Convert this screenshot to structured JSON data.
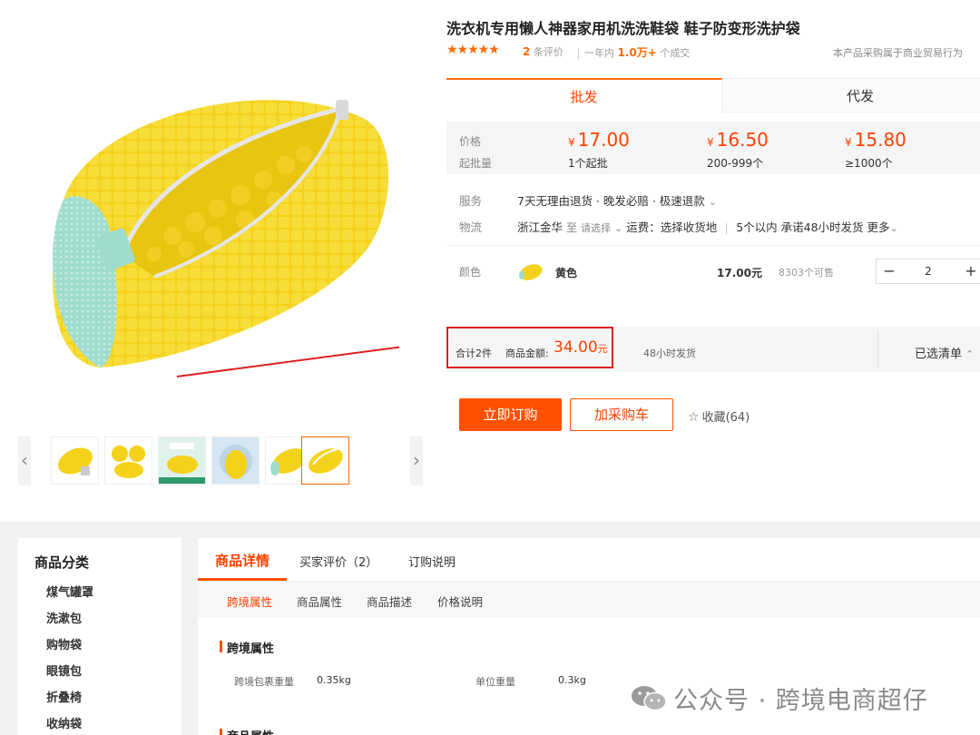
{
  "product": {
    "title": "洗衣机专用懒人神器家用机洗洗鞋袋 鞋子防变形洗护袋",
    "stars": "★★★★★",
    "review_count": "2",
    "review_suffix": "条评价",
    "sold_prefix": "一年内",
    "sold_count": "1.0万+",
    "sold_suffix": "个成交",
    "notice": "本产品采购属于商业贸易行为"
  },
  "gallery": {
    "prev": "‹",
    "next": "›",
    "main_image": "yellow-shoe-wash-bag-photo",
    "thumbnail_count": 6,
    "active_thumbnail": 6
  },
  "tabs": {
    "wholesale": "批发",
    "dropship": "代发"
  },
  "pricing": {
    "price_label": "价格",
    "moq_label": "起批量",
    "currency": "¥",
    "tiers": [
      {
        "price": "17.00",
        "qty": "1个起批"
      },
      {
        "price": "16.50",
        "qty": "200-999个"
      },
      {
        "price": "15.80",
        "qty": "≥1000个"
      }
    ]
  },
  "service": {
    "label": "服务",
    "value": "7天无理由退货 · 晚发必赔 · 极速退款",
    "chevron": "⌄"
  },
  "logistics": {
    "label": "物流",
    "origin": "浙江金华",
    "to": "至",
    "select": "请选择",
    "chevron": "⌄",
    "freight": "运费：选择收货地",
    "promise": "5个以内 承诺48小时发货",
    "more": "更多"
  },
  "sku": {
    "label": "颜色",
    "name": "黄色",
    "price": "17.00元",
    "stock": "8303个可售",
    "minus": "−",
    "plus": "+",
    "quantity": "2"
  },
  "summary": {
    "count": "合计2件",
    "amount_label": "商品金额:",
    "amount": "34.00",
    "amount_unit": "元",
    "shipping": "48小时发货",
    "selected_list": "已选清单",
    "chevron": "⌃"
  },
  "actions": {
    "buy_now": "立即订购",
    "add_cart": "加采购车",
    "favorite_icon": "☆",
    "favorite": "收藏(64)"
  },
  "categories": {
    "title": "商品分类",
    "items": [
      "煤气罐罩",
      "洗漱包",
      "购物袋",
      "眼镜包",
      "折叠椅",
      "收纳袋"
    ]
  },
  "detail": {
    "tabs": [
      "商品详情",
      "买家评价（2）",
      "订购说明"
    ],
    "subtabs": [
      "跨境属性",
      "商品属性",
      "商品描述",
      "价格说明"
    ],
    "section_title": "跨境属性",
    "attributes": [
      {
        "name": "跨境包裹重量",
        "value": "0.35kg"
      },
      {
        "name": "单位重量",
        "value": "0.3kg"
      }
    ],
    "next_section": "商品属性"
  },
  "watermark": "公众号 · 跨境电商超仔",
  "colors": {
    "accent": "#ff5000",
    "price": "#ff4000",
    "highlight_box": "#e02020"
  }
}
